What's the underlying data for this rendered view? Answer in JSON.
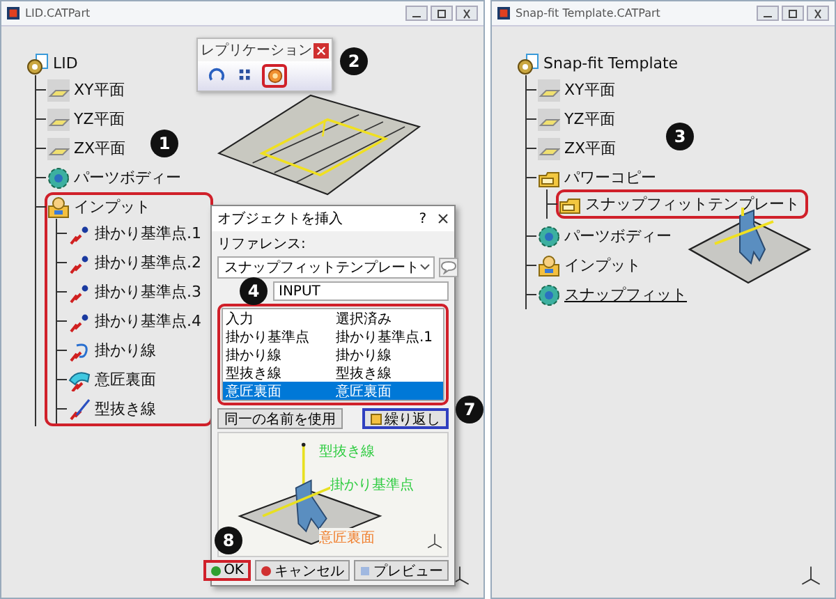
{
  "windows": [
    {
      "title": "LID.CATPart",
      "tree": {
        "label": "LID",
        "kind": "part",
        "children": [
          {
            "label": "XY平面",
            "kind": "plane",
            "highlighted": false
          },
          {
            "label": "YZ平面",
            "kind": "plane",
            "highlighted": false
          },
          {
            "label": "ZX平面",
            "kind": "plane",
            "highlighted": false
          },
          {
            "label": "パーツボディー",
            "kind": "body",
            "highlighted": false
          },
          {
            "label": "インプット",
            "kind": "geoset",
            "highlighted": true,
            "children": [
              {
                "label": "掛かり基準点.1",
                "kind": "point",
                "highlighted": false
              },
              {
                "label": "掛かり基準点.2",
                "kind": "point",
                "highlighted": false
              },
              {
                "label": "掛かり基準点.3",
                "kind": "point",
                "highlighted": false
              },
              {
                "label": "掛かり基準点.4",
                "kind": "point",
                "highlighted": false
              },
              {
                "label": "掛かり線",
                "kind": "curve",
                "highlighted": false
              },
              {
                "label": "意匠裏面",
                "kind": "surface",
                "highlighted": false
              },
              {
                "label": "型抜き線",
                "kind": "line",
                "highlighted": false
              }
            ]
          }
        ]
      },
      "toolbar": {
        "title": "レプリケーション",
        "buttons": [
          {
            "kind": "rotate",
            "highlighted": false
          },
          {
            "kind": "grid",
            "highlighted": false
          },
          {
            "kind": "instantiate",
            "highlighted": true,
            "color": "#d0202a"
          }
        ]
      },
      "dialog": {
        "title": "オブジェクトを挿入",
        "help": "?",
        "reference_label": "リファレンス:",
        "reference_value": "スナップフィットテンプレート",
        "input_value": "INPUT",
        "table": {
          "highlighted": true,
          "columns": [
            "入力",
            "選択済み"
          ],
          "rows": [
            {
              "cells": [
                "掛かり基準点",
                "掛かり基準点.1"
              ],
              "selected": false
            },
            {
              "cells": [
                "掛かり線",
                "掛かり線"
              ],
              "selected": false
            },
            {
              "cells": [
                "型抜き線",
                "型抜き線"
              ],
              "selected": false
            },
            {
              "cells": [
                "意匠裏面",
                "意匠裏面"
              ],
              "selected": true
            }
          ]
        },
        "buttons": [
          {
            "label": "同一の名前を使用",
            "highlighted": false
          },
          {
            "label": "繰り返し",
            "highlighted": true,
            "color": "#3040c0"
          }
        ],
        "preview_labels": [
          {
            "text": "型抜き線",
            "color": "#2ecc40"
          },
          {
            "text": "掛かり基準点",
            "color": "#2ecc40"
          },
          {
            "text": "意匠裏面",
            "color": "#f08030"
          }
        ],
        "footer_buttons": [
          {
            "label": "OK",
            "kind": "ok",
            "highlighted": true,
            "color": "#d0202a"
          },
          {
            "label": "キャンセル",
            "kind": "cancel",
            "highlighted": false
          },
          {
            "label": "プレビュー",
            "kind": "preview",
            "highlighted": false
          }
        ]
      }
    },
    {
      "title": "Snap-fit Template.CATPart",
      "tree": {
        "label": "Snap-fit Template",
        "kind": "part",
        "children": [
          {
            "label": "XY平面",
            "kind": "plane",
            "highlighted": false,
            "underlined": false
          },
          {
            "label": "YZ平面",
            "kind": "plane",
            "highlighted": false,
            "underlined": false
          },
          {
            "label": "ZX平面",
            "kind": "plane",
            "highlighted": false,
            "underlined": false
          },
          {
            "label": "パワーコピー",
            "kind": "powercopy",
            "highlighted": false,
            "underlined": false,
            "children": [
              {
                "label": "スナップフィットテンプレート",
                "kind": "powercopy",
                "highlighted": true,
                "underlined": false
              }
            ]
          },
          {
            "label": "パーツボディー",
            "kind": "body",
            "highlighted": false,
            "underlined": false
          },
          {
            "label": "インプット",
            "kind": "geoset",
            "highlighted": false,
            "underlined": false
          },
          {
            "label": "スナップフィット",
            "kind": "body",
            "highlighted": false,
            "underlined": true
          }
        ]
      }
    }
  ],
  "callouts": [
    {
      "number": "1"
    },
    {
      "number": "2"
    },
    {
      "number": "3"
    },
    {
      "number": "4"
    },
    {
      "number": "7"
    },
    {
      "number": "8"
    }
  ]
}
